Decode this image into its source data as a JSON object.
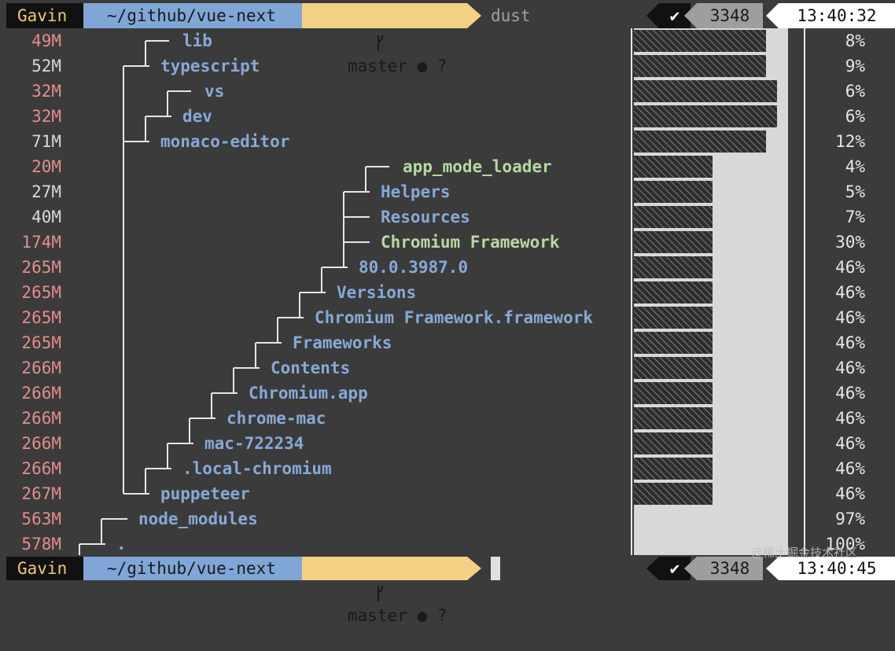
{
  "top_prompt": {
    "user": "Gavin",
    "path": "~/github/vue-next",
    "git_branch": "master ● ?",
    "command": "dust",
    "status_check": "✔",
    "status_code": "3348",
    "time": "13:40:32"
  },
  "bottom_prompt": {
    "user": "Gavin",
    "path": "~/github/vue-next",
    "git_branch": "master ● ?",
    "status_check": "✔",
    "status_code": "3348",
    "time": "13:40:45"
  },
  "rows": [
    {
      "size": "49M",
      "name": "lib",
      "pct": "8%",
      "name_color": "blue",
      "size_color": "red",
      "bar_fill": 0.08
    },
    {
      "size": "52M",
      "name": "typescript",
      "pct": "9%",
      "name_color": "blue",
      "size_color": "gray",
      "bar_fill": 0.09
    },
    {
      "size": "32M",
      "name": "vs",
      "pct": "6%",
      "name_color": "blue",
      "size_color": "red",
      "bar_fill": 0.06
    },
    {
      "size": "32M",
      "name": "dev",
      "pct": "6%",
      "name_color": "blue",
      "size_color": "red",
      "bar_fill": 0.06
    },
    {
      "size": "71M",
      "name": "monaco-editor",
      "pct": "12%",
      "name_color": "blue",
      "size_color": "gray",
      "bar_fill": 0.12
    },
    {
      "size": "20M",
      "name": "app_mode_loader",
      "pct": "4%",
      "name_color": "green",
      "size_color": "red",
      "bar_fill": 0.04
    },
    {
      "size": "27M",
      "name": "Helpers",
      "pct": "5%",
      "name_color": "blue",
      "size_color": "gray",
      "bar_fill": 0.05
    },
    {
      "size": "40M",
      "name": "Resources",
      "pct": "7%",
      "name_color": "blue",
      "size_color": "gray",
      "bar_fill": 0.07
    },
    {
      "size": "174M",
      "name": "Chromium Framework",
      "pct": "30%",
      "name_color": "green",
      "size_color": "red",
      "bar_fill": 0.3
    },
    {
      "size": "265M",
      "name": "80.0.3987.0",
      "pct": "46%",
      "name_color": "blue",
      "size_color": "red",
      "bar_fill": 0.46
    },
    {
      "size": "265M",
      "name": "Versions",
      "pct": "46%",
      "name_color": "blue",
      "size_color": "red",
      "bar_fill": 0.46
    },
    {
      "size": "265M",
      "name": "Chromium Framework.framework",
      "pct": "46%",
      "name_color": "blue",
      "size_color": "red",
      "bar_fill": 0.46
    },
    {
      "size": "265M",
      "name": "Frameworks",
      "pct": "46%",
      "name_color": "blue",
      "size_color": "red",
      "bar_fill": 0.46
    },
    {
      "size": "266M",
      "name": "Contents",
      "pct": "46%",
      "name_color": "blue",
      "size_color": "red",
      "bar_fill": 0.46
    },
    {
      "size": "266M",
      "name": "Chromium.app",
      "pct": "46%",
      "name_color": "blue",
      "size_color": "red",
      "bar_fill": 0.46
    },
    {
      "size": "266M",
      "name": "chrome-mac",
      "pct": "46%",
      "name_color": "blue",
      "size_color": "red",
      "bar_fill": 0.46
    },
    {
      "size": "266M",
      "name": "mac-722234",
      "pct": "46%",
      "name_color": "blue",
      "size_color": "red",
      "bar_fill": 0.46
    },
    {
      "size": "266M",
      "name": ".local-chromium",
      "pct": "46%",
      "name_color": "blue",
      "size_color": "red",
      "bar_fill": 0.46
    },
    {
      "size": "267M",
      "name": "puppeteer",
      "pct": "46%",
      "name_color": "blue",
      "size_color": "red",
      "bar_fill": 0.46
    },
    {
      "size": "563M",
      "name": "node_modules",
      "pct": "97%",
      "name_color": "blue",
      "size_color": "red",
      "bar_fill": 0.97
    },
    {
      "size": "578M",
      "name": ".",
      "pct": "100%",
      "name_color": "blue",
      "size_color": "red",
      "bar_fill": 1.0
    }
  ],
  "colors": {
    "background": "#3b3b3b",
    "user_bg": "#111111",
    "user_fg": "#f5c86b",
    "path_bg": "#7fa6d6",
    "git_bg": "#f3d184",
    "name_blue": "#86a9d8",
    "name_green": "#b7d8a0",
    "size_red": "#e38d8d",
    "bar_light": "#d8d8d8"
  },
  "icons": {
    "git_branch": "git-branch-icon",
    "status_ok": "checkmark-icon"
  },
  "watermark": "@稀土掘金技术社区"
}
